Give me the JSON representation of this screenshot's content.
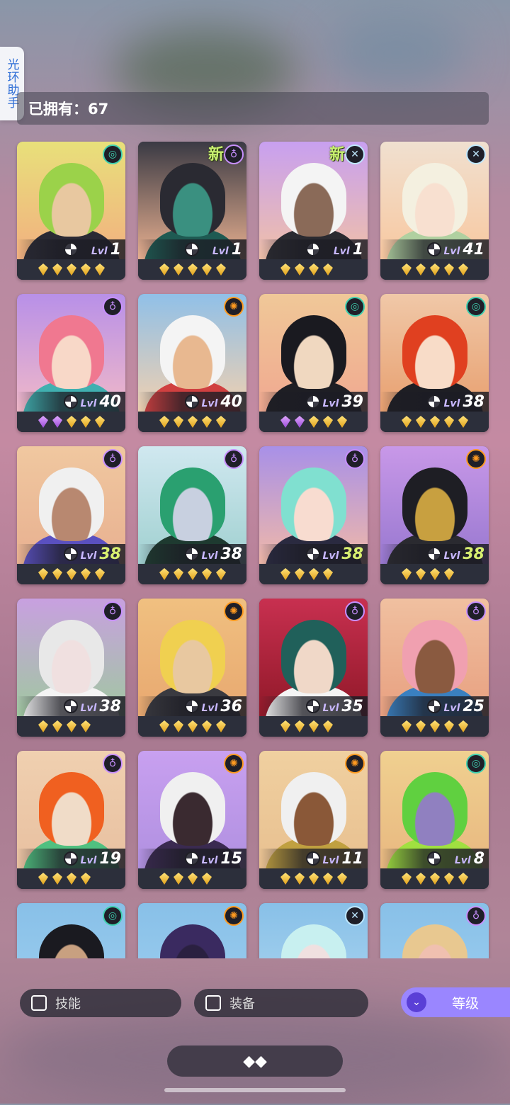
{
  "side_tab": {
    "label": "光环助手"
  },
  "owned": {
    "text": "已拥有：67"
  },
  "level_prefix": "Lvl",
  "new_label": "新",
  "cards": [
    {
      "level": "1",
      "new": false,
      "element": "spiral-icon",
      "elem_color": "#3fd0b0",
      "bg": [
        "#e8e07a",
        "#f2b080"
      ],
      "hair": "#9bd24a",
      "skin": "#e8c8a0",
      "outfit": "#2a2a34",
      "stars": 5,
      "purple": 0,
      "hi": false
    },
    {
      "level": "1",
      "new": true,
      "element": "keyhole-icon",
      "elem_color": "#c890ff",
      "bg": [
        "#3a3a44",
        "#e8b090"
      ],
      "hair": "#2a2a32",
      "skin": "#3a9080",
      "outfit": "#1e5a52",
      "stars": 5,
      "purple": 0,
      "hi": false
    },
    {
      "level": "1",
      "new": true,
      "element": "cross-icon",
      "elem_color": "#bfe8ff",
      "bg": [
        "#c8a0f0",
        "#f0c0a8"
      ],
      "hair": "#f4f4f4",
      "skin": "#8a6a58",
      "outfit": "#2a2a30",
      "stars": 4,
      "purple": 0,
      "hi": false
    },
    {
      "level": "41",
      "new": false,
      "element": "cross-icon",
      "elem_color": "#bfe8ff",
      "bg": [
        "#f0e0d0",
        "#f8c8a0"
      ],
      "hair": "#f4f0e0",
      "skin": "#f8e0d0",
      "outfit": "#b0d0a0",
      "stars": 5,
      "purple": 0,
      "hi": false
    },
    {
      "level": "40",
      "new": false,
      "element": "keyhole-icon",
      "elem_color": "#c890ff",
      "bg": [
        "#b890e8",
        "#f0b8c8"
      ],
      "hair": "#f07890",
      "skin": "#f8d8c8",
      "outfit": "#40b0b0",
      "stars": 5,
      "purple": 2,
      "hi": false
    },
    {
      "level": "40",
      "new": false,
      "element": "sun-icon",
      "elem_color": "#ff9a20",
      "bg": [
        "#90c0e8",
        "#f0d0b0"
      ],
      "hair": "#f4f4f4",
      "skin": "#e8b890",
      "outfit": "#d04040",
      "stars": 5,
      "purple": 0,
      "hi": false
    },
    {
      "level": "39",
      "new": false,
      "element": "spiral-icon",
      "elem_color": "#3fd0b0",
      "bg": [
        "#f0c898",
        "#f0a890"
      ],
      "hair": "#1a1a20",
      "skin": "#f0d8c0",
      "outfit": "#1e1e24",
      "stars": 5,
      "purple": 2,
      "hi": false
    },
    {
      "level": "38",
      "new": false,
      "element": "spiral-icon",
      "elem_color": "#3fd0b0",
      "bg": [
        "#f0c8a8",
        "#e8a070"
      ],
      "hair": "#e04020",
      "skin": "#f8dcc8",
      "outfit": "#1e1e24",
      "stars": 5,
      "purple": 0,
      "hi": false
    },
    {
      "level": "38",
      "new": false,
      "element": "keyhole-icon",
      "elem_color": "#c890ff",
      "bg": [
        "#f0c8a0",
        "#e8b090"
      ],
      "hair": "#f0f0f0",
      "skin": "#b88870",
      "outfit": "#5a50c0",
      "stars": 5,
      "purple": 0,
      "hi": true
    },
    {
      "level": "38",
      "new": false,
      "element": "keyhole-icon",
      "elem_color": "#c890ff",
      "bg": [
        "#d0e8f0",
        "#a0d0d0"
      ],
      "hair": "#2aa070",
      "skin": "#c8d0e0",
      "outfit": "#1e3a30",
      "stars": 5,
      "purple": 0,
      "hi": false
    },
    {
      "level": "38",
      "new": false,
      "element": "keyhole-icon",
      "elem_color": "#c890ff",
      "bg": [
        "#a890e8",
        "#f0b8a8"
      ],
      "hair": "#80e0d0",
      "skin": "#f8dcd0",
      "outfit": "#2a2a40",
      "stars": 4,
      "purple": 0,
      "hi": true
    },
    {
      "level": "38",
      "new": false,
      "element": "sun-icon",
      "elem_color": "#ff9a20",
      "bg": [
        "#c898e8",
        "#9878d0"
      ],
      "hair": "#1e1e24",
      "skin": "#c8a040",
      "outfit": "#2a2a30",
      "stars": 4,
      "purple": 0,
      "hi": true
    },
    {
      "level": "38",
      "new": false,
      "element": "keyhole-icon",
      "elem_color": "#c890ff",
      "bg": [
        "#c8a0e0",
        "#a0c8a0"
      ],
      "hair": "#e8e8e8",
      "skin": "#f0e0e0",
      "outfit": "#f4f4f4",
      "stars": 4,
      "purple": 0,
      "hi": false
    },
    {
      "level": "36",
      "new": false,
      "element": "sun-icon",
      "elem_color": "#ff9a20",
      "bg": [
        "#f0c080",
        "#e8a870"
      ],
      "hair": "#f0d050",
      "skin": "#e8c8a0",
      "outfit": "#3a3a40",
      "stars": 5,
      "purple": 0,
      "hi": false
    },
    {
      "level": "35",
      "new": false,
      "element": "keyhole-icon",
      "elem_color": "#c890ff",
      "bg": [
        "#c83050",
        "#901828"
      ],
      "hair": "#20605a",
      "skin": "#f0d8c8",
      "outfit": "#f4f4f4",
      "stars": 4,
      "purple": 0,
      "hi": false
    },
    {
      "level": "25",
      "new": false,
      "element": "keyhole-icon",
      "elem_color": "#c890ff",
      "bg": [
        "#f0c0a0",
        "#e8a080"
      ],
      "hair": "#f0a0b0",
      "skin": "#8a5a40",
      "outfit": "#3a80c0",
      "stars": 5,
      "purple": 0,
      "hi": false
    },
    {
      "level": "19",
      "new": false,
      "element": "keyhole-icon",
      "elem_color": "#c890ff",
      "bg": [
        "#f0d0b0",
        "#e8c0a0"
      ],
      "hair": "#f06020",
      "skin": "#f0dcc8",
      "outfit": "#50c080",
      "stars": 4,
      "purple": 0,
      "hi": false
    },
    {
      "level": "15",
      "new": false,
      "element": "sun-icon",
      "elem_color": "#ff9a20",
      "bg": [
        "#c8a0f0",
        "#b090e0"
      ],
      "hair": "#f0f0f0",
      "skin": "#3a2a30",
      "outfit": "#3a2a50",
      "stars": 4,
      "purple": 0,
      "hi": false
    },
    {
      "level": "11",
      "new": false,
      "element": "sun-icon",
      "elem_color": "#ff9a20",
      "bg": [
        "#f0d0a0",
        "#e8c090"
      ],
      "hair": "#f0f0f0",
      "skin": "#8a5838",
      "outfit": "#c0a040",
      "stars": 5,
      "purple": 0,
      "hi": false
    },
    {
      "level": "8",
      "new": false,
      "element": "spiral-icon",
      "elem_color": "#3fd0b0",
      "bg": [
        "#f0d090",
        "#e8b880"
      ],
      "hair": "#60d040",
      "skin": "#9080c0",
      "outfit": "#a0e040",
      "stars": 5,
      "purple": 0,
      "hi": false
    },
    {
      "level": "",
      "new": false,
      "element": "spiral-icon",
      "elem_color": "#3fd0b0",
      "bg": [
        "#88c0e8",
        "#a0d0f0"
      ],
      "hair": "#1a1a20",
      "skin": "#c8a080",
      "outfit": "#1e1e24",
      "stars": 0,
      "purple": 0,
      "hi": false
    },
    {
      "level": "",
      "new": false,
      "element": "sun-icon",
      "elem_color": "#ff9a20",
      "bg": [
        "#88c0e8",
        "#a0d0f0"
      ],
      "hair": "#3a2a60",
      "skin": "#2a2040",
      "outfit": "#2a2040",
      "stars": 0,
      "purple": 0,
      "hi": false
    },
    {
      "level": "",
      "new": false,
      "element": "cross-icon",
      "elem_color": "#bfe8ff",
      "bg": [
        "#88c0e8",
        "#b0d8f0"
      ],
      "hair": "#c8f0f0",
      "skin": "#f0e0e0",
      "outfit": "#e0e0e0",
      "stars": 0,
      "purple": 0,
      "hi": false
    },
    {
      "level": "",
      "new": false,
      "element": "keyhole-icon",
      "elem_color": "#c890ff",
      "bg": [
        "#88c0e8",
        "#a0d0f0"
      ],
      "hair": "#e8c890",
      "skin": "#f0c0b0",
      "outfit": "#e8a0a0",
      "stars": 0,
      "purple": 0,
      "hi": false
    }
  ],
  "filters": {
    "skills": "技能",
    "equipment": "装备"
  },
  "sort": {
    "label": "等级"
  },
  "bottom": {
    "icon": "◆◆"
  }
}
